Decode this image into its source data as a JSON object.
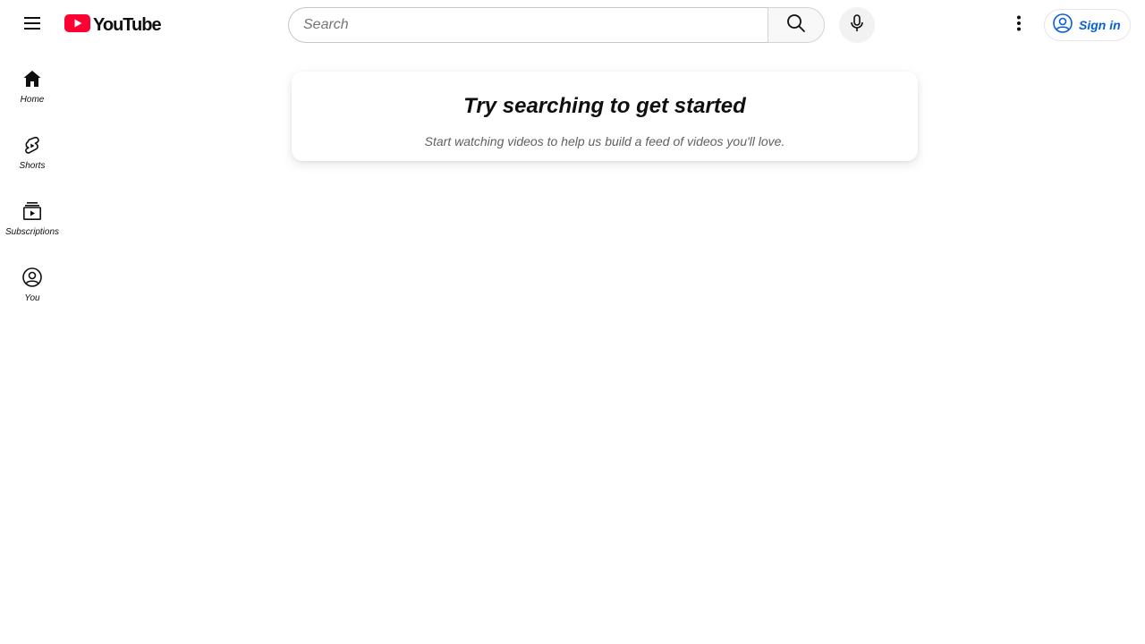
{
  "masthead": {
    "logo_text": "YouTube",
    "menu_icon": "hamburger-menu-icon",
    "search": {
      "placeholder": "Search",
      "value": ""
    },
    "search_icon": "search-icon",
    "voice_icon": "microphone-icon",
    "more_icon": "vertical-dots-icon",
    "sign_in_label": "Sign in",
    "sign_in_icon": "account-circle-icon"
  },
  "sidebar": {
    "items": [
      {
        "label": "Home",
        "icon": "home-icon"
      },
      {
        "label": "Shorts",
        "icon": "shorts-icon"
      },
      {
        "label": "Subscriptions",
        "icon": "subscriptions-icon"
      },
      {
        "label": "You",
        "icon": "account-circle-icon"
      }
    ]
  },
  "main": {
    "prompt_title": "Try searching to get started",
    "prompt_subtitle": "Start watching videos to help us build a feed of videos you'll love."
  },
  "colors": {
    "brand_red": "#ff0033",
    "link_blue": "#065fd4",
    "text_primary": "#0f0f0f",
    "text_secondary": "#606060"
  }
}
